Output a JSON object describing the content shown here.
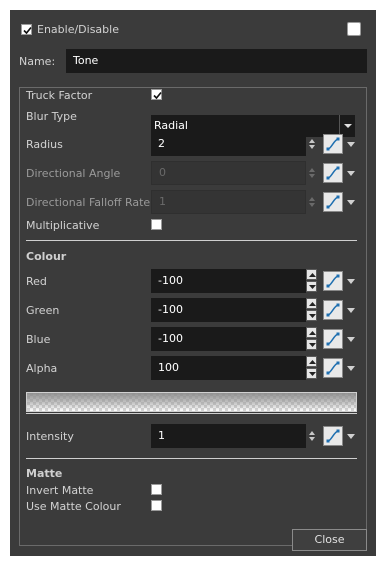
{
  "header": {
    "enable_label": "Enable/Disable",
    "enable_checked": true,
    "name_label": "Name:",
    "name_value": "Tone"
  },
  "params": {
    "truck_factor_label": "Truck Factor",
    "truck_factor_checked": true,
    "blur_type_label": "Blur Type",
    "blur_type_value": "Radial",
    "radius_label": "Radius",
    "radius_value": "2",
    "directional_angle_label": "Directional Angle",
    "directional_angle_value": "0",
    "directional_falloff_label": "Directional Falloff Rate",
    "directional_falloff_value": "1",
    "multiplicative_label": "Multiplicative",
    "multiplicative_checked": false
  },
  "colour": {
    "section_label": "Colour",
    "red_label": "Red",
    "red_value": "-100",
    "green_label": "Green",
    "green_value": "-100",
    "blue_label": "Blue",
    "blue_value": "-100",
    "alpha_label": "Alpha",
    "alpha_value": "100"
  },
  "intensity": {
    "label": "Intensity",
    "value": "1"
  },
  "matte": {
    "section_label": "Matte",
    "invert_label": "Invert Matte",
    "invert_checked": false,
    "use_colour_label": "Use Matte Colour",
    "use_colour_checked": false
  },
  "footer": {
    "close_label": "Close"
  },
  "colors": {
    "window_bg": "#3b3b3b",
    "field_bg": "#1a1a1a",
    "accent_curve": "#1f6fb0"
  }
}
